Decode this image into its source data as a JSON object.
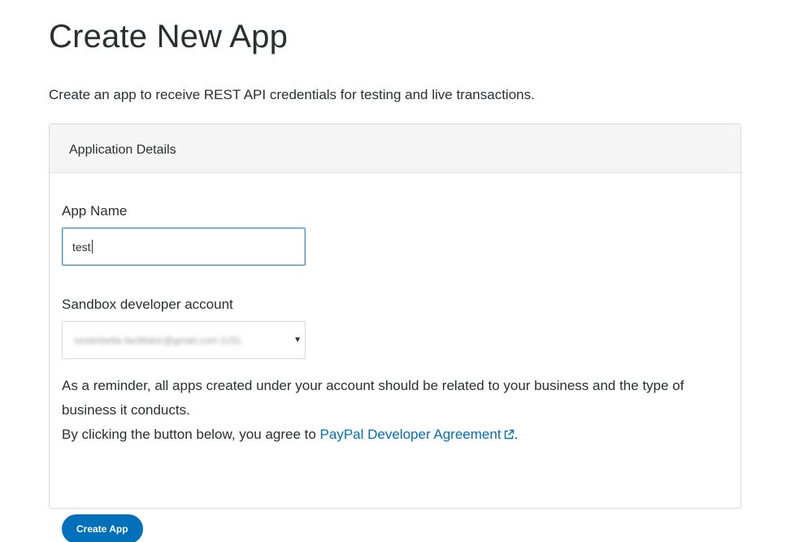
{
  "header": {
    "title": "Create New App",
    "subtitle": "Create an app to receive REST API credentials for testing and live transactions."
  },
  "panel": {
    "title": "Application Details"
  },
  "form": {
    "app_name": {
      "label": "App Name",
      "value": "test"
    },
    "sandbox_account": {
      "label": "Sandbox developer account",
      "selected_value": "vesterbella-facilitator@gmail.com (US)"
    },
    "reminder_text": "As a reminder, all apps created under your account should be related to your business and the type of business it conducts.",
    "agreement_prefix": "By clicking the button below, you agree to ",
    "agreement_link": "PayPal Developer Agreement",
    "agreement_suffix": ".",
    "submit_label": "Create App"
  },
  "icons": {
    "external_link": "external-link-icon",
    "select_caret": "caret-down-icon"
  },
  "colors": {
    "brand_blue": "#0070ba",
    "input_focus_border": "#4c8cbf",
    "panel_header_bg": "#f5f5f5",
    "text": "#2c2e2f"
  }
}
